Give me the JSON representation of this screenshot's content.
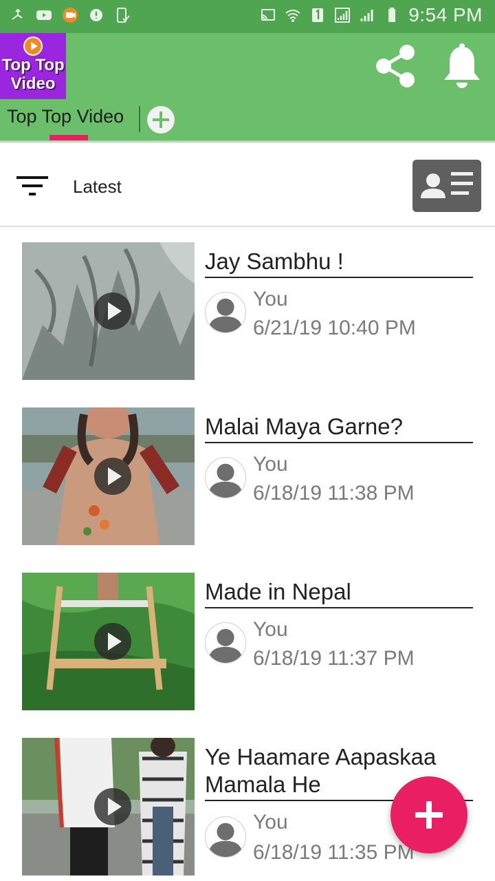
{
  "status_bar": {
    "time": "9:54 PM",
    "left_icons": [
      "usb-debug-icon",
      "youtube-icon",
      "camera-app-icon",
      "data-saver-icon",
      "screenshot-icon"
    ],
    "right_icons": [
      "cast-icon",
      "wifi-icon",
      "sim-1-icon",
      "signal-icon",
      "signal-2-icon",
      "battery-icon"
    ]
  },
  "toolbar": {
    "logo_line1": "Top Top",
    "logo_line2": "Video",
    "share_icon": "share-icon",
    "bell_icon": "bell-icon",
    "tabs": [
      {
        "label": "Top Top Video",
        "active": true
      }
    ],
    "add_tab_icon": "add-tab-icon",
    "color": "#6bbf6b",
    "accent": "#e91e63"
  },
  "filter": {
    "icon": "filter-icon",
    "label": "Latest",
    "contact_icon": "contact-card-icon"
  },
  "videos": [
    {
      "title": "Jay Sambhu !",
      "author": "You",
      "date": "6/21/19 10:40 PM"
    },
    {
      "title": "Malai Maya Garne?",
      "author": "You",
      "date": "6/18/19 11:38 PM"
    },
    {
      "title": "Made in Nepal",
      "author": "You",
      "date": "6/18/19 11:37 PM"
    },
    {
      "title": "Ye Haamare Aapaskaa Mamala He",
      "author": "You",
      "date": "6/18/19 11:35 PM"
    }
  ],
  "fab": {
    "icon": "add-icon",
    "color": "#e91e63"
  }
}
